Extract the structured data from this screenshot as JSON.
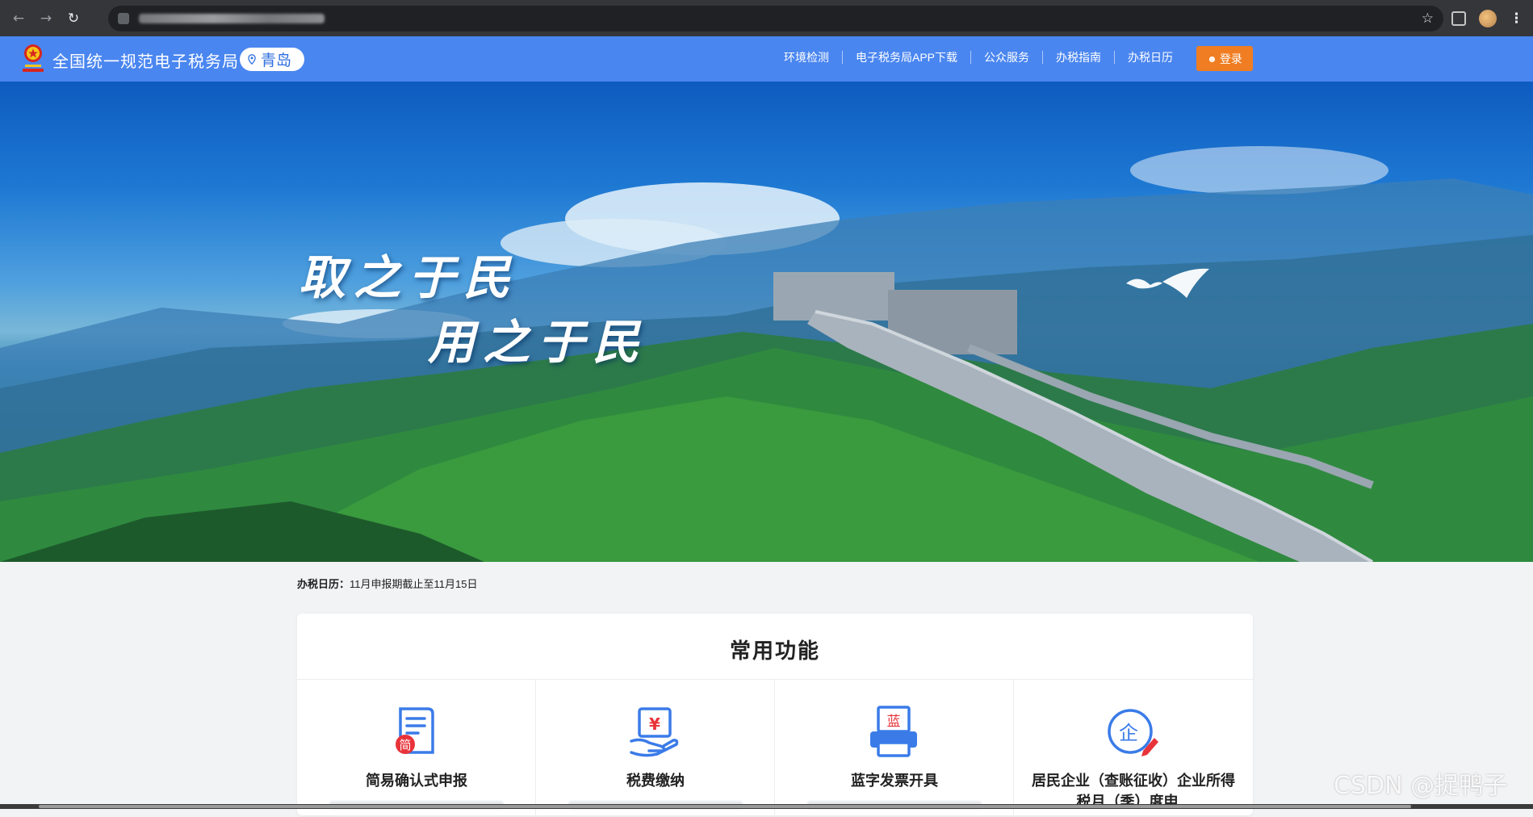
{
  "browser": {
    "back_icon": "arrow-left-icon",
    "forward_icon": "arrow-right-icon",
    "reload_icon": "reload-icon",
    "bookmark_icon": "star-icon",
    "extensions_icon": "puzzle-icon",
    "menu_icon": "kebab-icon"
  },
  "header": {
    "title": "全国统一规范电子税务局",
    "region": "青岛",
    "nav": [
      "环境检测",
      "电子税务局APP下载",
      "公众服务",
      "办税指南",
      "办税日历"
    ],
    "login_label": "登录",
    "bg_color": "#4a86f0",
    "login_color": "#f07d22"
  },
  "hero": {
    "slogan_line1": "取之于民",
    "slogan_line2": "用之于民"
  },
  "notice": {
    "label": "办税日历：",
    "text": "11月申报期截止至11月15日"
  },
  "functions": {
    "title": "常用功能",
    "items": [
      {
        "label": "简易确认式申报",
        "icon": "simple-declaration-icon",
        "badge": "简"
      },
      {
        "label": "税费缴纳",
        "icon": "tax-payment-icon",
        "badge": "¥"
      },
      {
        "label": "蓝字发票开具",
        "icon": "blue-invoice-printer-icon",
        "badge": "蓝"
      },
      {
        "label": "居民企业（查账征收）企业所得税月（季）度申...",
        "icon": "enterprise-income-tax-icon",
        "badge": "企"
      }
    ]
  },
  "watermark": "CSDN @捉鸭子"
}
